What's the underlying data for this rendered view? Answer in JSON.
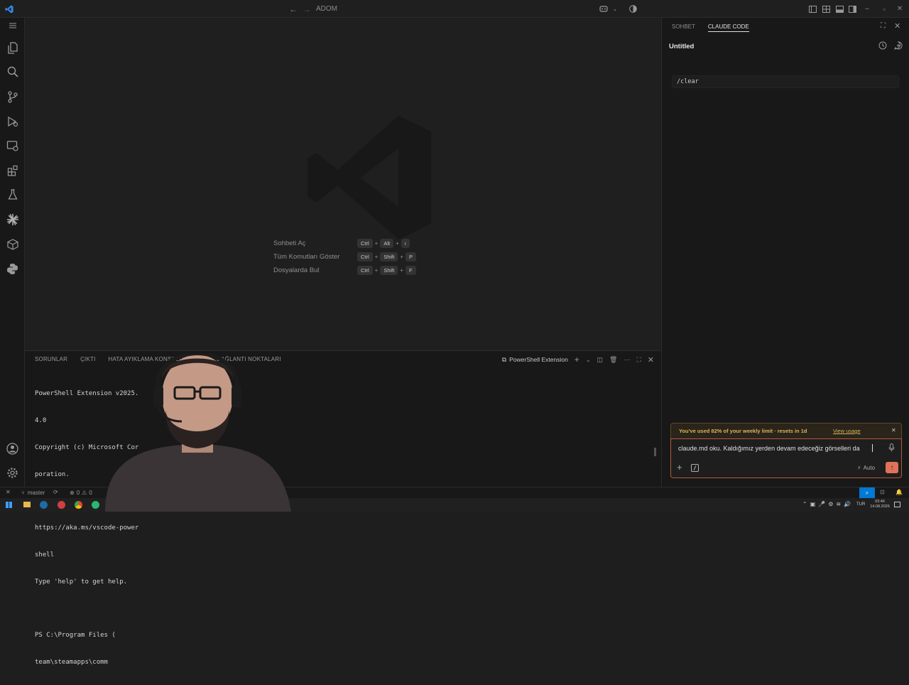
{
  "titlebar": {
    "search_text": "ADOM",
    "icons": [
      "vscode-logo-icon",
      "back-arrow-icon",
      "forward-arrow-icon",
      "copilot-icon",
      "chevron-down-icon",
      "accounts-pie-icon",
      "toggle-sidebar-icon",
      "layout-icon",
      "toggle-panel-icon",
      "toggle-secondary-sidebar-icon",
      "minimize-icon",
      "restore-icon",
      "close-icon"
    ]
  },
  "activity_bar": {
    "icons": [
      "menu-icon",
      "explorer-icon",
      "search-icon",
      "source-control-icon",
      "run-debug-icon",
      "remote-explorer-icon",
      "extensions-icon",
      "testing-icon",
      "claude-icon",
      "package-icon",
      "python-icon",
      "account-icon",
      "settings-gear-icon"
    ]
  },
  "editor": {
    "shortcuts": [
      {
        "label": "Sohbeti Aç",
        "keys": [
          "Ctrl",
          "Alt",
          "ı"
        ]
      },
      {
        "label": "Tüm Komutları Göster",
        "keys": [
          "Ctrl",
          "Shift",
          "P"
        ]
      },
      {
        "label": "Dosyalarda Bul",
        "keys": [
          "Ctrl",
          "Shift",
          "F"
        ]
      }
    ]
  },
  "panel": {
    "tabs": [
      "SORUNLAR",
      "ÇIKTI",
      "HATA AYIKLAMA KONSOLU",
      "TE",
      "DAĞLANTI NOKTALARI"
    ],
    "terminal_name": "PowerShell Extension",
    "terminal_lines": [
      "PowerShell Extension v2025.",
      "4.0",
      "Copyright (c) Microsoft Cor",
      "poration.",
      "",
      "https://aka.ms/vscode-power",
      "shell",
      "Type 'help' to get help.",
      "",
      "PS C:\\Program Files (",
      "team\\steamapps\\comm"
    ]
  },
  "side_panel": {
    "tabs": [
      "SOHBET",
      "CLAUDE CODE"
    ],
    "active_tab": "CLAUDE CODE",
    "title": "Untitled",
    "message": "/clear",
    "usage_text": "You've used 82% of your weekly limit · resets in 1d",
    "usage_link": "View usage",
    "input_value": "claude.md oku. Kaldığımız yerden devam edeceğiz görselleri da",
    "mode_label": "Auto"
  },
  "statusbar": {
    "branch": "master",
    "errors": "0",
    "warnings": "0"
  },
  "taskbar": {
    "lang": "TUR",
    "time": "03:46",
    "date": "14.08.2026"
  },
  "colors": {
    "accent": "#0078d4",
    "usage_warning": "#d8b45a",
    "send_button": "#e0715a"
  }
}
